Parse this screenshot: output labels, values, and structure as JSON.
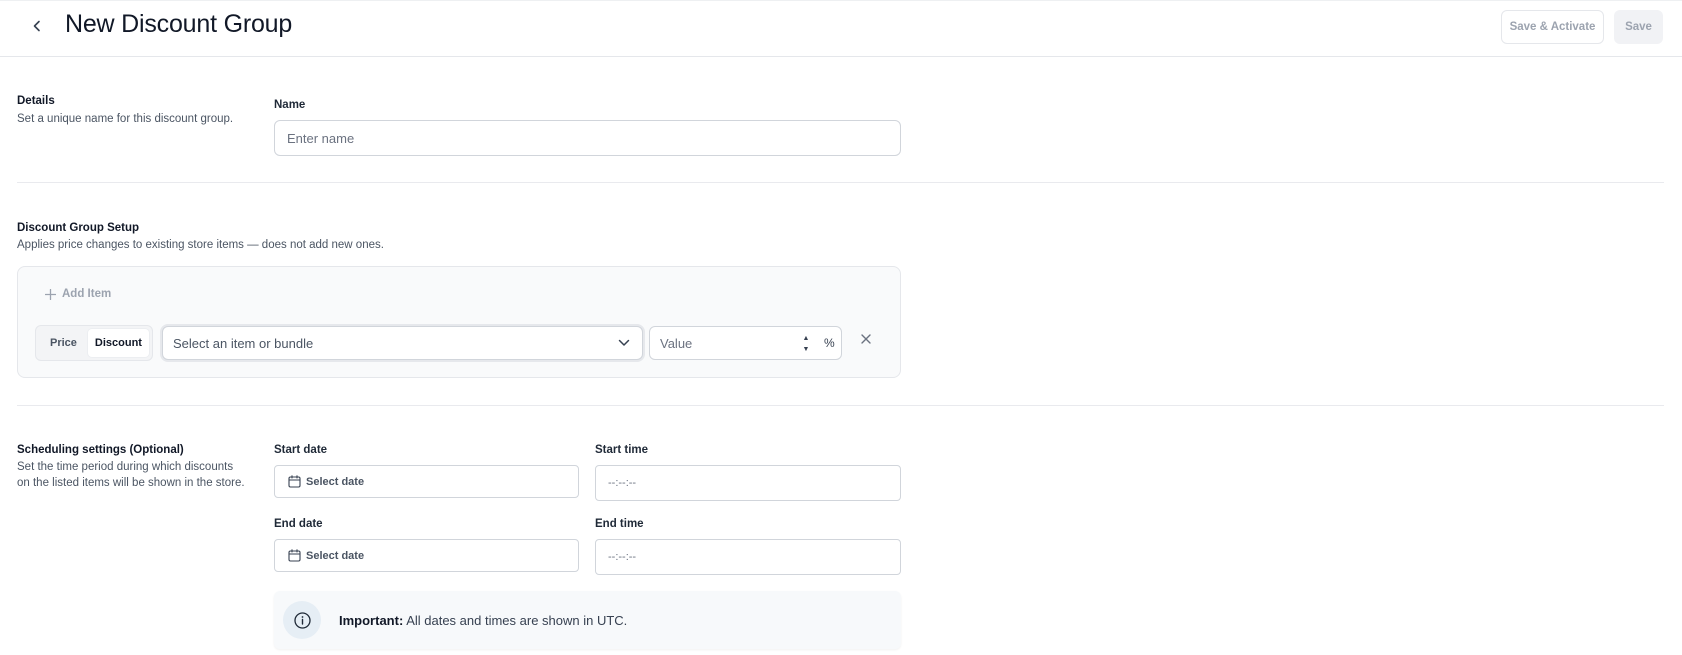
{
  "header": {
    "title": "New Discount Group",
    "save_activate_label": "Save & Activate",
    "save_label": "Save"
  },
  "details": {
    "title": "Details",
    "description": "Set a unique name for this discount group.",
    "name_label": "Name",
    "name_placeholder": "Enter name",
    "name_value": ""
  },
  "setup": {
    "title": "Discount Group Setup",
    "description": "Applies price changes to existing store items — does not add new ones.",
    "add_item_label": "Add Item",
    "row": {
      "mode_options": [
        "Price",
        "Discount"
      ],
      "selected_mode": "Discount",
      "item_placeholder": "Select an item or bundle",
      "value_placeholder": "Value",
      "unit": "%"
    }
  },
  "scheduling": {
    "title": "Scheduling settings (Optional)",
    "description_line1": "Set the time period during which discounts",
    "description_line2": "on the listed items will be shown in the store.",
    "start_date_label": "Start date",
    "start_date_placeholder": "Select date",
    "start_time_label": "Start time",
    "start_time_placeholder": "--:--:--",
    "end_date_label": "End date",
    "end_date_placeholder": "Select date",
    "end_time_label": "End time",
    "end_time_placeholder": "--:--:--",
    "notice_bold": "Important:",
    "notice_text": "All dates and times are shown in UTC."
  },
  "icons": [
    "chevron-left-icon",
    "plus-icon",
    "chevron-down-icon",
    "close-icon",
    "calendar-icon",
    "info-icon"
  ]
}
